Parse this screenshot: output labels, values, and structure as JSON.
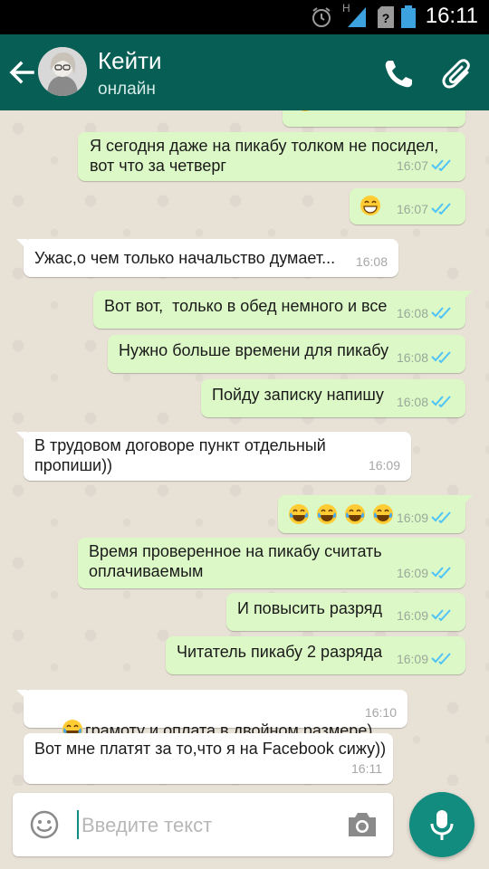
{
  "status_bar": {
    "time": "16:11",
    "network_label": "H",
    "icons": [
      "alarm-icon",
      "signal-icon",
      "sim-unknown-icon",
      "battery-icon"
    ]
  },
  "header": {
    "contact_name": "Кейти",
    "contact_status": "онлайн",
    "icons": [
      "back-arrow-icon",
      "avatar",
      "phone-icon",
      "paperclip-icon"
    ]
  },
  "messages": [
    {
      "dir": "out",
      "text": "Я сегодня даже на пикабу толком не посидел,\nвот что за четверг",
      "time": "16:07",
      "read": true
    },
    {
      "dir": "out",
      "text": "",
      "emoji": [
        "grinning-face"
      ],
      "time": "16:07",
      "read": true
    },
    {
      "dir": "in",
      "text": "Ужас,о чем только начальство думает...",
      "time": "16:08"
    },
    {
      "dir": "out",
      "text": "Вот вот,  только в обед немного и все",
      "time": "16:08",
      "read": true
    },
    {
      "dir": "out",
      "text": "Нужно больше времени для пикабу",
      "time": "16:08",
      "read": true
    },
    {
      "dir": "out",
      "text": "Пойду записку напишу",
      "time": "16:08",
      "read": true
    },
    {
      "dir": "in",
      "text": "В трудовом договоре пункт отдельный\nпропиши))",
      "time": "16:09"
    },
    {
      "dir": "out",
      "text": "",
      "emoji": [
        "tears-of-joy",
        "tears-of-joy",
        "tears-of-joy",
        "tears-of-joy"
      ],
      "time": "16:09",
      "read": true
    },
    {
      "dir": "out",
      "text": "Время проверенное на пикабу считать\nоплачиваемым",
      "time": "16:09",
      "read": true
    },
    {
      "dir": "out",
      "text": "И повысить разряд",
      "time": "16:09",
      "read": true
    },
    {
      "dir": "out",
      "text": "Читатель пикабу 2 разряда",
      "time": "16:09",
      "read": true
    },
    {
      "dir": "in",
      "text": "грамоту и оплата в двойном размере)",
      "emoji_prefix": "tears-of-joy",
      "time": "16:10"
    },
    {
      "dir": "in",
      "text": "Вот мне платят за то,что я на Facebook сижу))",
      "time": "16:11"
    }
  ],
  "input": {
    "placeholder": "Введите текст",
    "value": ""
  },
  "colors": {
    "header": "#075e54",
    "accent": "#128c7e",
    "outgoing_bubble": "#dcf8c6",
    "incoming_bubble": "#ffffff",
    "read_ticks": "#4fc3f7",
    "chat_background": "#e8e1d6"
  }
}
